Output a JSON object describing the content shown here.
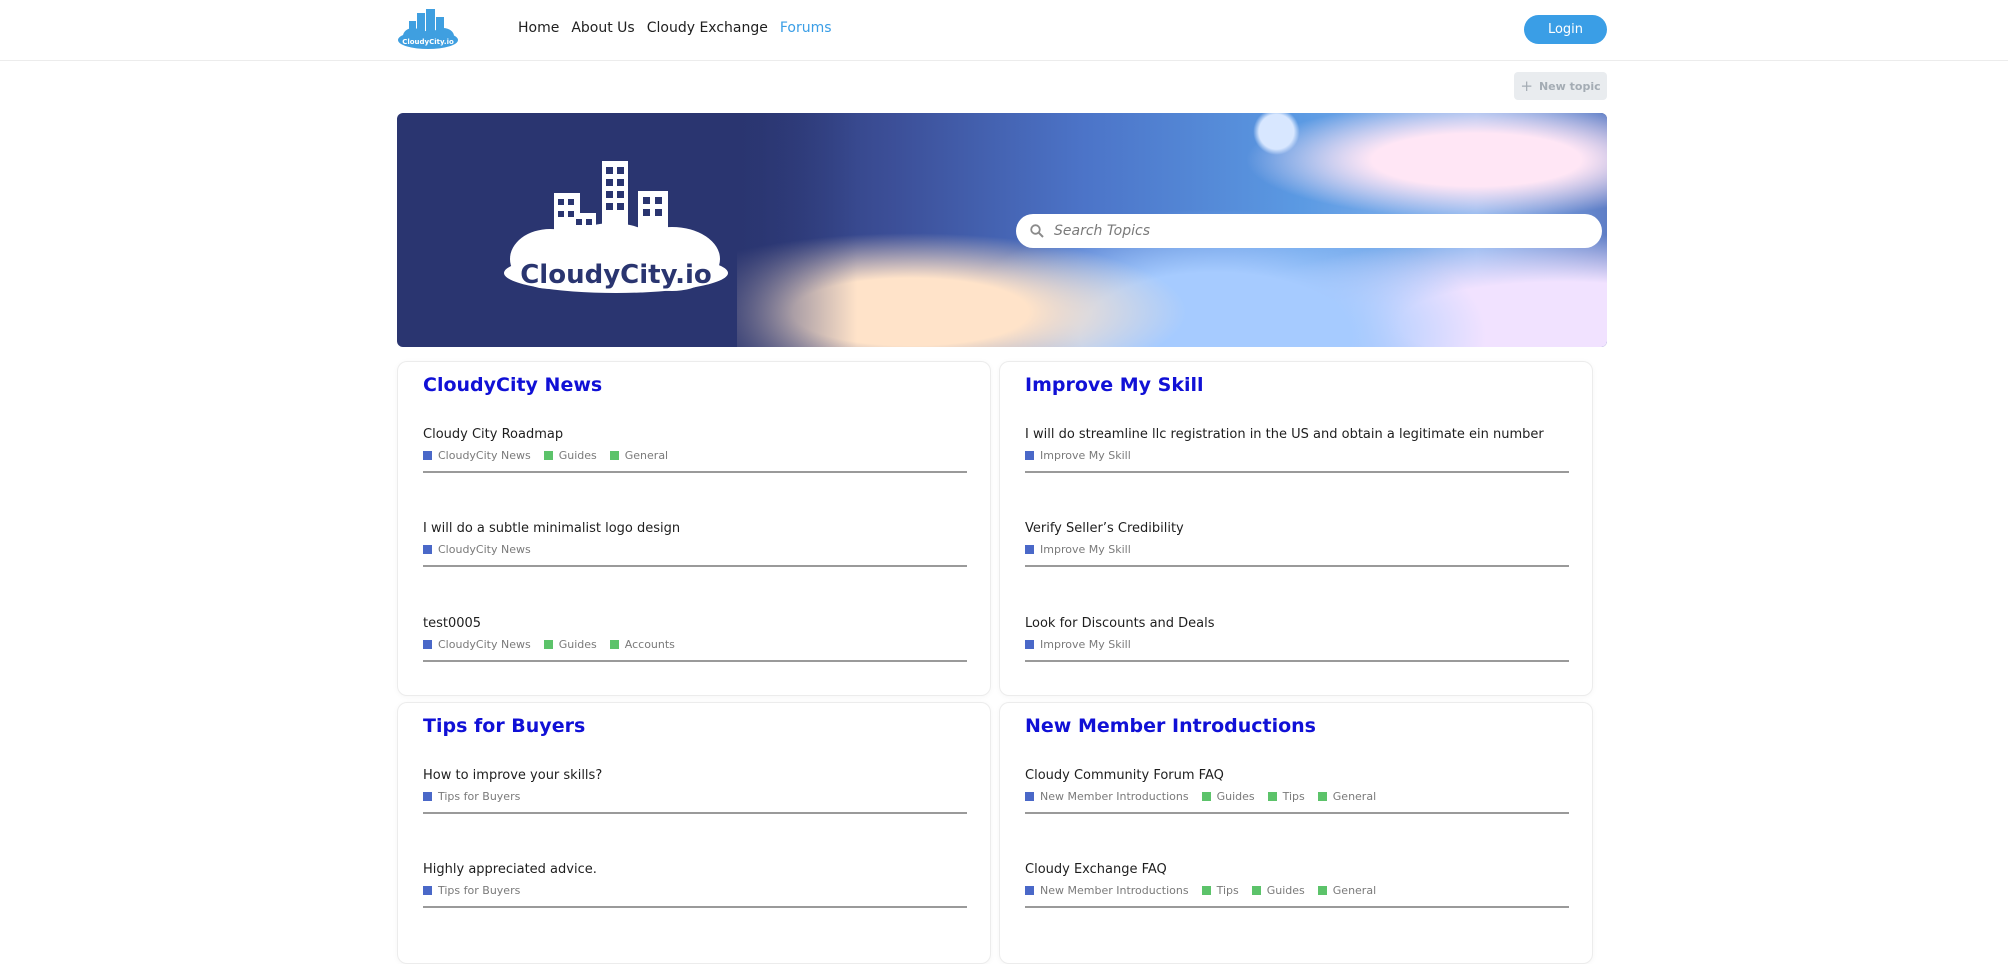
{
  "header": {
    "logo_text": "CloudyCity.io",
    "nav": [
      {
        "label": "Home",
        "active": false
      },
      {
        "label": "About Us",
        "active": false
      },
      {
        "label": "Cloudy Exchange",
        "active": false
      },
      {
        "label": "Forums",
        "active": true
      }
    ],
    "login_label": "Login"
  },
  "toolbar": {
    "new_topic_label": "New topic"
  },
  "banner": {
    "logo_text": "CloudyCity.io",
    "search_placeholder": "Search Topics"
  },
  "colors": {
    "accent": "#3a9ee6",
    "card_title": "#1010d6",
    "tag_category": "#4a68c8",
    "tag_label": "#5cc36a"
  },
  "cards": [
    {
      "title": "CloudyCity News",
      "topics": [
        {
          "title": "Cloudy City Roadmap",
          "tags": [
            {
              "label": "CloudyCity News",
              "kind": "category"
            },
            {
              "label": "Guides",
              "kind": "tag"
            },
            {
              "label": "General",
              "kind": "tag"
            }
          ]
        },
        {
          "title": "I will do a subtle minimalist logo design",
          "tags": [
            {
              "label": "CloudyCity News",
              "kind": "category"
            }
          ]
        },
        {
          "title": "test0005",
          "tags": [
            {
              "label": "CloudyCity News",
              "kind": "category"
            },
            {
              "label": "Guides",
              "kind": "tag"
            },
            {
              "label": "Accounts",
              "kind": "tag"
            }
          ]
        }
      ]
    },
    {
      "title": "Improve My Skill",
      "topics": [
        {
          "title": "I will do streamline llc registration in the US and obtain a legitimate ein number",
          "tags": [
            {
              "label": "Improve My Skill",
              "kind": "category"
            }
          ]
        },
        {
          "title": "Verify Seller’s Credibility",
          "tags": [
            {
              "label": "Improve My Skill",
              "kind": "category"
            }
          ]
        },
        {
          "title": "Look for Discounts and Deals",
          "tags": [
            {
              "label": "Improve My Skill",
              "kind": "category"
            }
          ]
        }
      ]
    },
    {
      "title": "Tips for Buyers",
      "topics": [
        {
          "title": "How to improve your skills?",
          "tags": [
            {
              "label": "Tips for Buyers",
              "kind": "category"
            }
          ]
        },
        {
          "title": "Highly appreciated advice.",
          "tags": [
            {
              "label": "Tips for Buyers",
              "kind": "category"
            }
          ]
        }
      ]
    },
    {
      "title": "New Member Introductions",
      "topics": [
        {
          "title": "Cloudy Community Forum FAQ",
          "tags": [
            {
              "label": "New Member Introductions",
              "kind": "category"
            },
            {
              "label": "Guides",
              "kind": "tag"
            },
            {
              "label": "Tips",
              "kind": "tag"
            },
            {
              "label": "General",
              "kind": "tag"
            }
          ]
        },
        {
          "title": "Cloudy Exchange FAQ",
          "tags": [
            {
              "label": "New Member Introductions",
              "kind": "category"
            },
            {
              "label": "Tips",
              "kind": "tag"
            },
            {
              "label": "Guides",
              "kind": "tag"
            },
            {
              "label": "General",
              "kind": "tag"
            }
          ]
        }
      ]
    }
  ]
}
